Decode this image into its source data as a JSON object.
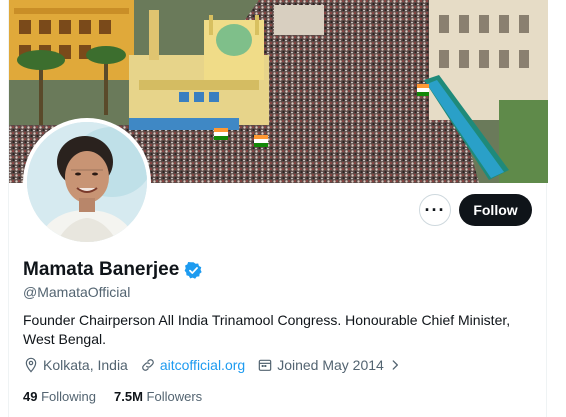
{
  "profile": {
    "name": "Mamata Banerjee",
    "handle": "@MamataOfficial",
    "bio": "Founder Chairperson All India Trinamool Congress. Honourable Chief Minister, West Bengal.",
    "location": "Kolkata, India",
    "website": "aitcofficial.org",
    "joined": "Joined May 2014",
    "verified": true
  },
  "actions": {
    "more_label": "···",
    "follow_label": "Follow"
  },
  "stats": {
    "following_count": "49",
    "following_label": "Following",
    "followers_count": "7.5M",
    "followers_label": "Followers"
  },
  "icons": {
    "verified": "verified-badge-icon",
    "location": "location-pin-icon",
    "link": "link-icon",
    "calendar": "calendar-icon",
    "chevron": "chevron-right-icon"
  },
  "colors": {
    "accent": "#1d9bf0",
    "text_primary": "#0f1419",
    "text_secondary": "#536471",
    "follow_bg": "#0f1419"
  }
}
